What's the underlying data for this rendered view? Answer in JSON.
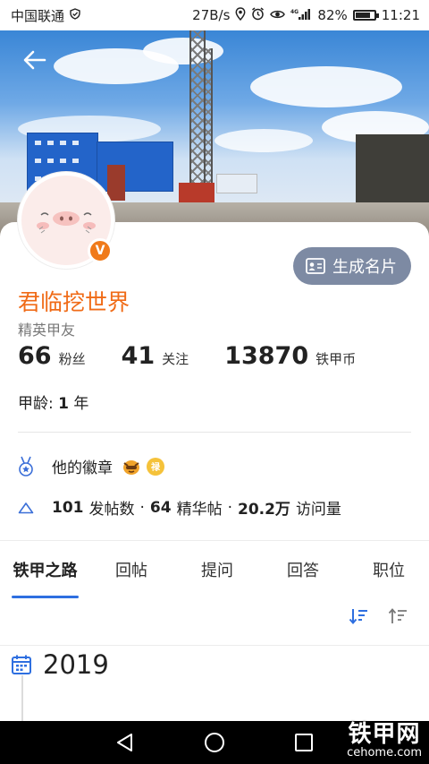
{
  "status_bar": {
    "carrier": "中国联通",
    "speed": "27B/s",
    "network": "4G",
    "battery": "82%",
    "battery_level": 0.82,
    "time": "11:21"
  },
  "profile": {
    "name": "君临挖世界",
    "title": "精英甲友",
    "verified_badge": "V",
    "card_button": "生成名片"
  },
  "stats": [
    {
      "num": "66",
      "label": "粉丝"
    },
    {
      "num": "41",
      "label": "关注"
    },
    {
      "num": "13870",
      "label": "铁甲币"
    }
  ],
  "age": {
    "label": "甲龄:",
    "value": "1",
    "unit": "年"
  },
  "badges": {
    "label": "他的徽章",
    "badge_text": "禄"
  },
  "activity": {
    "posts": "101",
    "posts_label": "发帖数",
    "sep": "·",
    "featured": "64",
    "featured_label": "精华帖",
    "views": "20.2万",
    "views_label": "访问量"
  },
  "tabs": [
    "铁甲之路",
    "回帖",
    "提问",
    "回答",
    "职位"
  ],
  "timeline": {
    "year": "2019"
  },
  "watermark": {
    "big": "铁甲网",
    "small": "cehome.com"
  },
  "colors": {
    "accent": "#2e6fe0",
    "name": "#f06b17",
    "button": "#7d8aa3"
  }
}
